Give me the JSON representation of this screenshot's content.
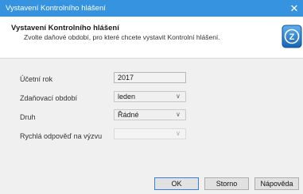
{
  "window": {
    "title": "Vystavení Kontrolního hlášení",
    "close_glyph": "✕"
  },
  "header": {
    "title": "Vystavení Kontrolního hlášení",
    "subtitle": "Zvolte daňové období, pro které chcete vystavit Kontrolní hlášení.",
    "logo_letter": "Z"
  },
  "form": {
    "year_label": "Účetní rok",
    "year_value": "2017",
    "period_label": "Zdaňovací období",
    "period_value": "leden",
    "type_label": "Druh",
    "type_value": "Řádné",
    "reply_label": "Rychlá odpověď na výzvu",
    "reply_value": ""
  },
  "buttons": {
    "ok": "OK",
    "cancel": "Storno",
    "help": "Nápověda"
  },
  "colors": {
    "titlebar": "#3593e0",
    "logo": "#1e74c8"
  }
}
